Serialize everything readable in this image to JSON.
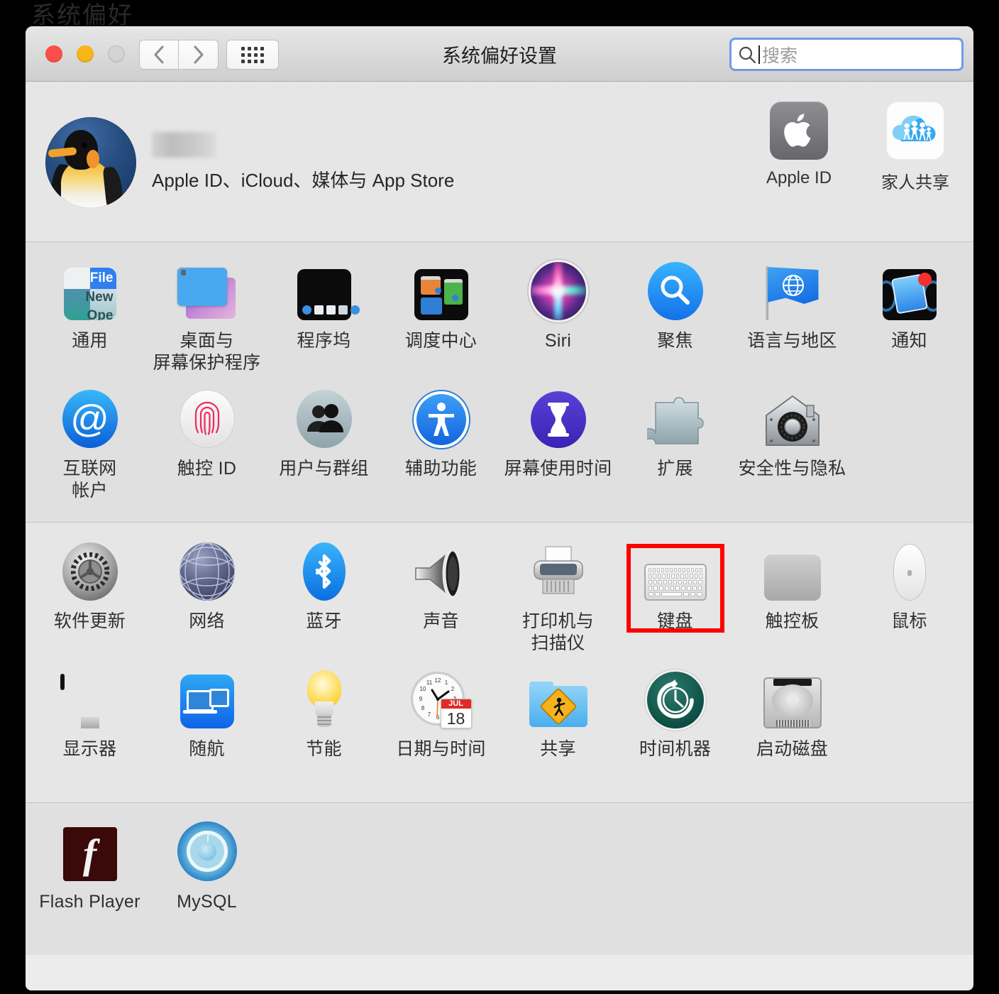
{
  "background": {
    "ghost_text": "系统偏好"
  },
  "window": {
    "title": "系统偏好设置",
    "traffic_lights": {
      "close": "close-button",
      "minimize": "minimize-button",
      "zoom": "zoom-button"
    },
    "nav": {
      "back": "back-button",
      "forward": "forward-button",
      "grid": "show-all-button"
    },
    "search": {
      "placeholder": "搜索",
      "value": "",
      "icon": "search-icon",
      "focused": true
    }
  },
  "account": {
    "name_redacted": "",
    "subtitle": "Apple ID、iCloud、媒体与 App Store",
    "avatar": "penguin-avatar",
    "tiles": [
      {
        "id": "apple-id",
        "label": "Apple ID",
        "icon": "apple-logo-icon"
      },
      {
        "id": "family-sharing",
        "label": "家人共享",
        "icon": "family-cloud-icon"
      }
    ]
  },
  "sections": [
    {
      "id": "personal",
      "items": [
        {
          "id": "general",
          "label": "通用",
          "icon": "general-icon"
        },
        {
          "id": "desktop",
          "label": "桌面与\n屏幕保护程序",
          "icon": "desktop-screensaver-icon"
        },
        {
          "id": "dock",
          "label": "程序坞",
          "icon": "dock-icon"
        },
        {
          "id": "mission-control",
          "label": "调度中心",
          "icon": "mission-control-icon"
        },
        {
          "id": "siri",
          "label": "Siri",
          "icon": "siri-icon"
        },
        {
          "id": "spotlight",
          "label": "聚焦",
          "icon": "spotlight-icon"
        },
        {
          "id": "language",
          "label": "语言与地区",
          "icon": "language-region-icon"
        },
        {
          "id": "notifications",
          "label": "通知",
          "icon": "notifications-icon"
        },
        {
          "id": "internet-accounts",
          "label": "互联网\n帐户",
          "icon": "internet-accounts-icon"
        },
        {
          "id": "touch-id",
          "label": "触控 ID",
          "icon": "touch-id-icon"
        },
        {
          "id": "users-groups",
          "label": "用户与群组",
          "icon": "users-groups-icon"
        },
        {
          "id": "accessibility",
          "label": "辅助功能",
          "icon": "accessibility-icon"
        },
        {
          "id": "screen-time",
          "label": "屏幕使用时间",
          "icon": "screen-time-icon"
        },
        {
          "id": "extensions",
          "label": "扩展",
          "icon": "extensions-icon"
        },
        {
          "id": "security",
          "label": "安全性与隐私",
          "icon": "security-privacy-icon"
        }
      ]
    },
    {
      "id": "hardware",
      "items": [
        {
          "id": "software-update",
          "label": "软件更新",
          "icon": "software-update-icon"
        },
        {
          "id": "network",
          "label": "网络",
          "icon": "network-icon"
        },
        {
          "id": "bluetooth",
          "label": "蓝牙",
          "icon": "bluetooth-icon"
        },
        {
          "id": "sound",
          "label": "声音",
          "icon": "sound-icon"
        },
        {
          "id": "printers",
          "label": "打印机与\n扫描仪",
          "icon": "printers-scanners-icon"
        },
        {
          "id": "keyboard",
          "label": "键盘",
          "icon": "keyboard-icon",
          "highlighted": true
        },
        {
          "id": "trackpad",
          "label": "触控板",
          "icon": "trackpad-icon"
        },
        {
          "id": "mouse",
          "label": "鼠标",
          "icon": "mouse-icon"
        },
        {
          "id": "displays",
          "label": "显示器",
          "icon": "displays-icon"
        },
        {
          "id": "sidecar",
          "label": "随航",
          "icon": "sidecar-icon"
        },
        {
          "id": "energy-saver",
          "label": "节能",
          "icon": "energy-saver-icon"
        },
        {
          "id": "date-time",
          "label": "日期与时间",
          "icon": "date-time-icon",
          "month": "JUL",
          "day": "18"
        },
        {
          "id": "sharing",
          "label": "共享",
          "icon": "sharing-icon"
        },
        {
          "id": "time-machine",
          "label": "时间机器",
          "icon": "time-machine-icon"
        },
        {
          "id": "startup-disk",
          "label": "启动磁盘",
          "icon": "startup-disk-icon"
        }
      ]
    },
    {
      "id": "third-party",
      "items": [
        {
          "id": "flash-player",
          "label": "Flash Player",
          "icon": "flash-player-icon"
        },
        {
          "id": "mysql",
          "label": "MySQL",
          "icon": "mysql-icon"
        }
      ]
    }
  ],
  "highlight": {
    "target": "keyboard",
    "color": "#fb0000"
  }
}
